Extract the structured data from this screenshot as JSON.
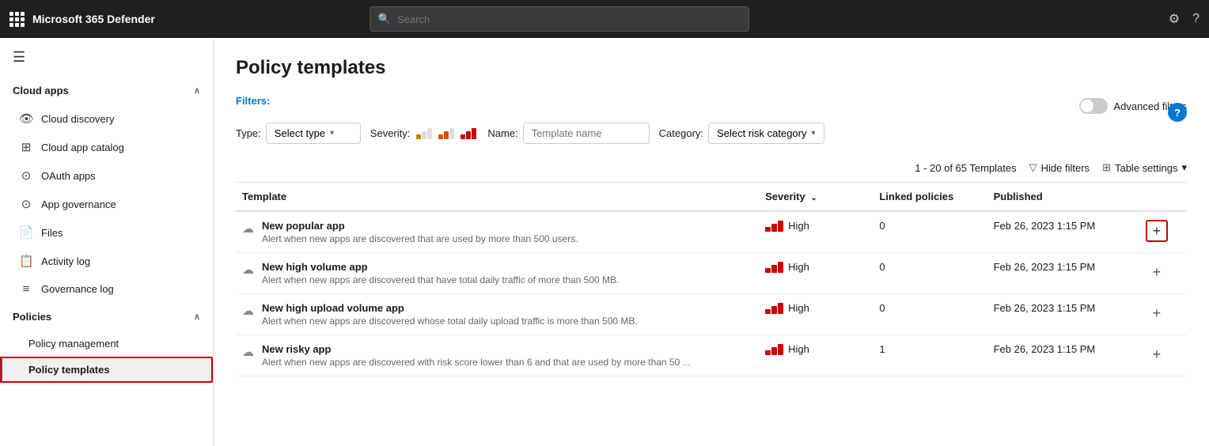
{
  "app": {
    "title": "Microsoft 365 Defender",
    "search_placeholder": "Search"
  },
  "sidebar": {
    "hamburger": "☰",
    "groups": [
      {
        "label": "Cloud apps",
        "expanded": true,
        "items": [
          {
            "id": "cloud-discovery",
            "label": "Cloud discovery",
            "icon": "👁"
          },
          {
            "id": "cloud-app-catalog",
            "label": "Cloud app catalog",
            "icon": "☰"
          },
          {
            "id": "oauth-apps",
            "label": "OAuth apps",
            "icon": "👤"
          },
          {
            "id": "app-governance",
            "label": "App governance",
            "icon": "👤"
          },
          {
            "id": "files",
            "label": "Files",
            "icon": "📄"
          },
          {
            "id": "activity-log",
            "label": "Activity log",
            "icon": "📋"
          },
          {
            "id": "governance-log",
            "label": "Governance log",
            "icon": "≡"
          }
        ]
      },
      {
        "label": "Policies",
        "expanded": true,
        "items": [
          {
            "id": "policy-management",
            "label": "Policy management",
            "icon": ""
          },
          {
            "id": "policy-templates",
            "label": "Policy templates",
            "icon": "",
            "active": true
          }
        ]
      }
    ]
  },
  "page": {
    "title": "Policy templates",
    "filters_label": "Filters:",
    "type_label": "Type:",
    "type_value": "Select type",
    "severity_label": "Severity:",
    "name_label": "Name:",
    "name_placeholder": "Template name",
    "category_label": "Category:",
    "category_value": "Select risk category",
    "advanced_filters_label": "Advanced filters",
    "table_count": "1 - 20 of 65 Templates",
    "hide_filters_label": "Hide filters",
    "table_settings_label": "Table settings"
  },
  "columns": {
    "template": "Template",
    "severity": "Severity",
    "linked_policies": "Linked policies",
    "published": "Published"
  },
  "rows": [
    {
      "name": "New popular app",
      "description": "Alert when new apps are discovered that are used by more than 500 users.",
      "severity_label": "High",
      "linked": "0",
      "published": "Feb 26, 2023 1:15 PM",
      "add_highlighted": true
    },
    {
      "name": "New high volume app",
      "description": "Alert when new apps are discovered that have total daily traffic of more than 500 MB.",
      "severity_label": "High",
      "linked": "0",
      "published": "Feb 26, 2023 1:15 PM",
      "add_highlighted": false
    },
    {
      "name": "New high upload volume app",
      "description": "Alert when new apps are discovered whose total daily upload traffic is more than 500 MB.",
      "severity_label": "High",
      "linked": "0",
      "published": "Feb 26, 2023 1:15 PM",
      "add_highlighted": false
    },
    {
      "name": "New risky app",
      "description": "Alert when new apps are discovered with risk score lower than 6 and that are used by more than 50 ...",
      "severity_label": "High",
      "linked": "1",
      "published": "Feb 26, 2023 1:15 PM",
      "add_highlighted": false
    }
  ]
}
